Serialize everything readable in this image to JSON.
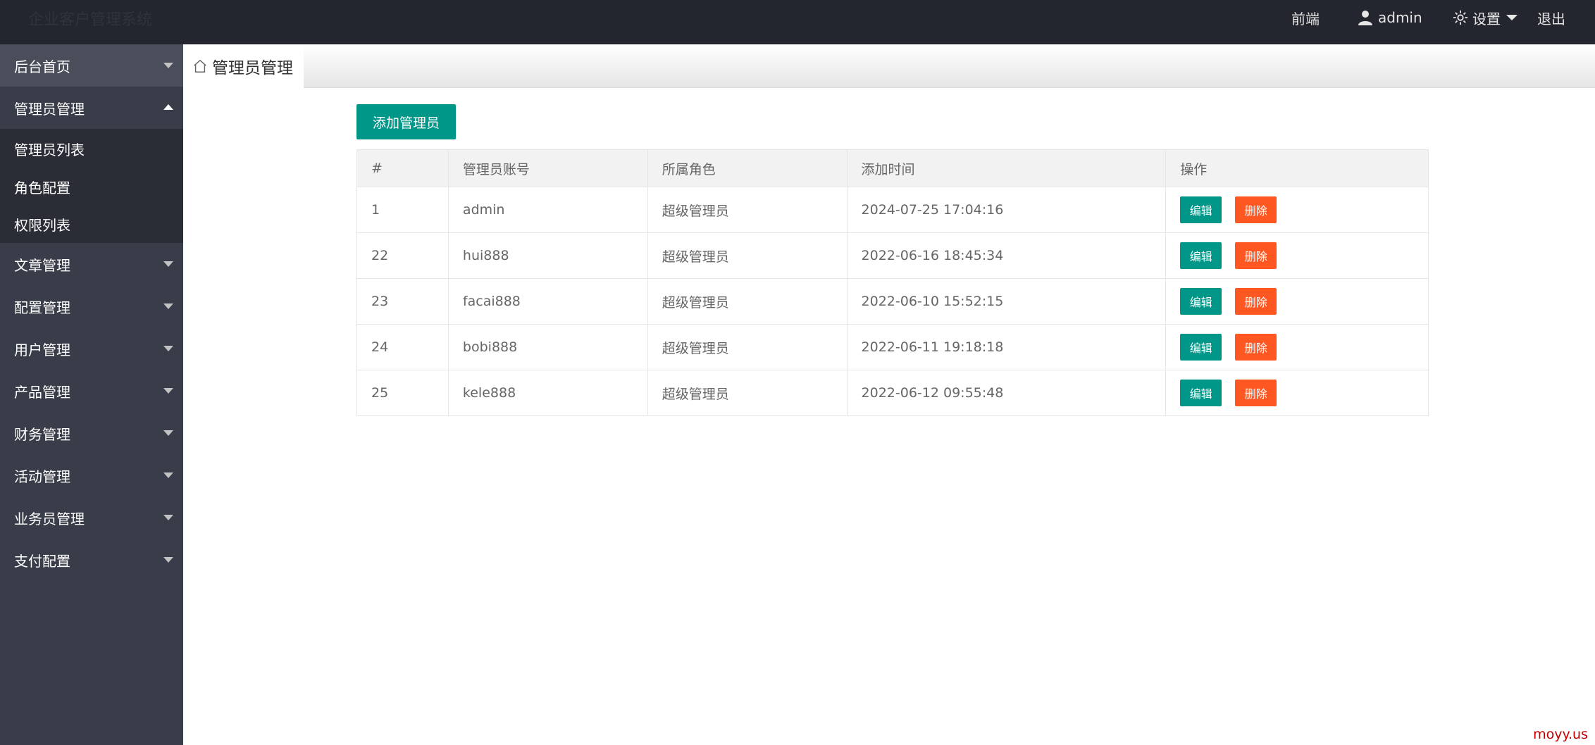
{
  "header": {
    "logo": "企业客户管理系统",
    "nav": {
      "frontend": "前端",
      "user": "admin",
      "settings": "设置",
      "logout": "退出"
    }
  },
  "sidebar": {
    "items": [
      {
        "label": "后台首页"
      },
      {
        "label": "管理员管理",
        "children": [
          "管理员列表",
          "角色配置",
          "权限列表"
        ]
      },
      {
        "label": "文章管理"
      },
      {
        "label": "配置管理"
      },
      {
        "label": "用户管理"
      },
      {
        "label": "产品管理"
      },
      {
        "label": "财务管理"
      },
      {
        "label": "活动管理"
      },
      {
        "label": "业务员管理"
      },
      {
        "label": "支付配置"
      }
    ]
  },
  "tab": {
    "label": "管理员管理"
  },
  "main": {
    "add_button": "添加管理员",
    "table": {
      "headers": [
        "#",
        "管理员账号",
        "所属角色",
        "添加时间",
        "操作"
      ],
      "rows": [
        {
          "id": "1",
          "account": "admin",
          "role": "超级管理员",
          "time": "2024-07-25 17:04:16"
        },
        {
          "id": "22",
          "account": "hui888",
          "role": "超级管理员",
          "time": "2022-06-16 18:45:34"
        },
        {
          "id": "23",
          "account": "facai888",
          "role": "超级管理员",
          "time": "2022-06-10 15:52:15"
        },
        {
          "id": "24",
          "account": "bobi888",
          "role": "超级管理员",
          "time": "2022-06-11 19:18:18"
        },
        {
          "id": "25",
          "account": "kele888",
          "role": "超级管理员",
          "time": "2022-06-12 09:55:48"
        }
      ],
      "edit_label": "编辑",
      "delete_label": "删除"
    }
  },
  "watermark": "moyy.us",
  "colors": {
    "header_bg": "#23262e",
    "sidebar_bg": "#393d49",
    "primary": "#009688",
    "danger": "#ff5722"
  }
}
